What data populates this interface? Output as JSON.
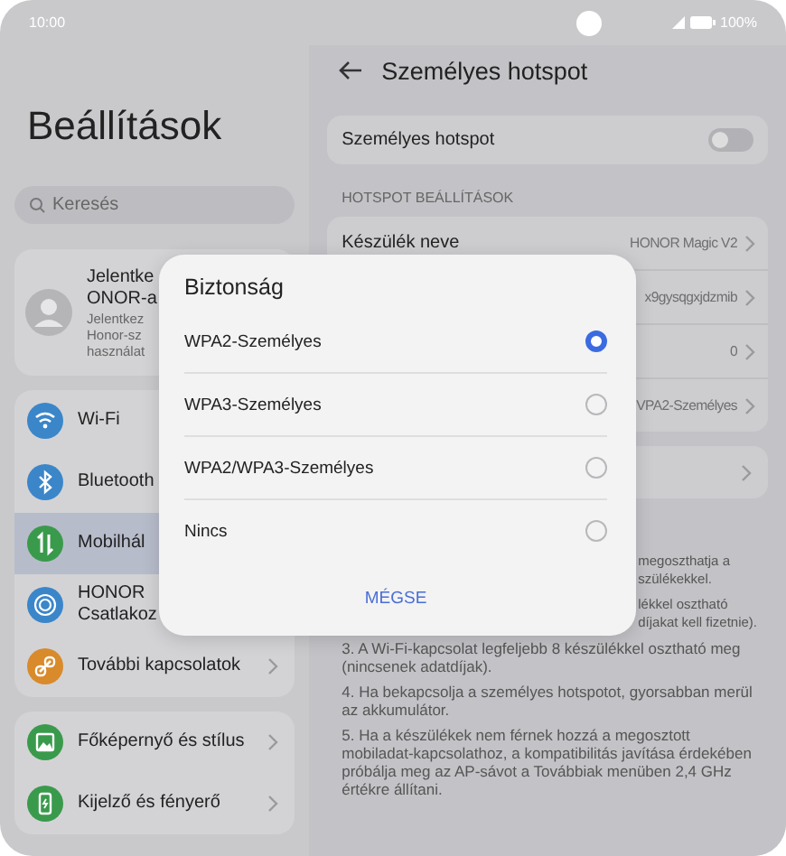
{
  "status_bar": {
    "time": "10:00",
    "battery": "100%"
  },
  "sidebar": {
    "title": "Beállítások",
    "search": {
      "placeholder": "Keresés"
    },
    "account": {
      "name_lines": [
        "Jelentke",
        "ONOR-a"
      ],
      "detail_lines": [
        "Jelentkez",
        "Honor-sz",
        "használat"
      ]
    },
    "groups": [
      {
        "items": [
          {
            "kind": "wifi",
            "label_lines": [
              "Wi-Fi"
            ],
            "color": "#3b86c9",
            "selected": false
          },
          {
            "kind": "bluetooth",
            "label_lines": [
              "Bluetooth"
            ],
            "color": "#3b86c9",
            "selected": false
          },
          {
            "kind": "mobile",
            "label_lines": [
              "Mobilhál"
            ],
            "color": "#3a9a4c",
            "selected": true
          },
          {
            "kind": "rings",
            "label_lines": [
              "HONOR",
              "Csatlakoz"
            ],
            "color": "#3b86c9",
            "selected": false
          },
          {
            "kind": "link",
            "label_lines": [
              "További kapcsolatok"
            ],
            "color": "#d98a2b",
            "selected": false,
            "chevron": true
          }
        ]
      },
      {
        "items": [
          {
            "kind": "image",
            "label_lines": [
              "Főképernyő és stílus"
            ],
            "color": "#3a9a4c",
            "selected": false,
            "chevron": true
          },
          {
            "kind": "phone",
            "label_lines": [
              "Kijelző és fényerő"
            ],
            "color": "#3a9a4c",
            "selected": false,
            "chevron": true
          }
        ]
      }
    ]
  },
  "hotspot": {
    "title": "Személyes hotspot",
    "switch_row": {
      "label": "Személyes hotspot",
      "on": false
    },
    "section": "HOTSPOT BEÁLLÍTÁSOK",
    "rows": [
      {
        "label": "Készülék neve",
        "value": "HONOR Magic V2"
      },
      {
        "value": "x9gysqgxjdzmib"
      },
      {
        "value": "0"
      },
      {
        "value": "VPA2-Személyes"
      }
    ],
    "notes": [
      {
        "kind": "fragment",
        "lines": [
          "megoszthatja a",
          "szülékekkel."
        ]
      },
      {
        "kind": "fragment",
        "lines": [
          "lékkel osztható",
          "díjakat kell fizetnie)."
        ]
      },
      {
        "kind": "full",
        "lines": [
          "3. A Wi-Fi-kapcsolat legfeljebb 8 készülékkel osztható meg (nincsenek adatdíjak)."
        ]
      },
      {
        "kind": "full",
        "lines": [
          "4. Ha bekapcsolja a személyes hotspotot, gyorsabban merül az akkumulátor."
        ]
      },
      {
        "kind": "full",
        "lines": [
          "5. Ha a készülékek nem férnek hozzá a megosztott mobiladat-kapcsolathoz, a kompatibilitás javítása érdekében próbálja meg az AP-sávot a Továbbiak menüben 2,4 GHz értékre állítani."
        ]
      }
    ]
  },
  "dialog": {
    "title": "Biztonság",
    "options": [
      {
        "label": "WPA2-Személyes",
        "selected": true
      },
      {
        "label": "WPA3-Személyes",
        "selected": false
      },
      {
        "label": "WPA2/WPA3-Személyes",
        "selected": false
      },
      {
        "label": "Nincs",
        "selected": false
      }
    ],
    "cancel": "MÉGSE"
  }
}
